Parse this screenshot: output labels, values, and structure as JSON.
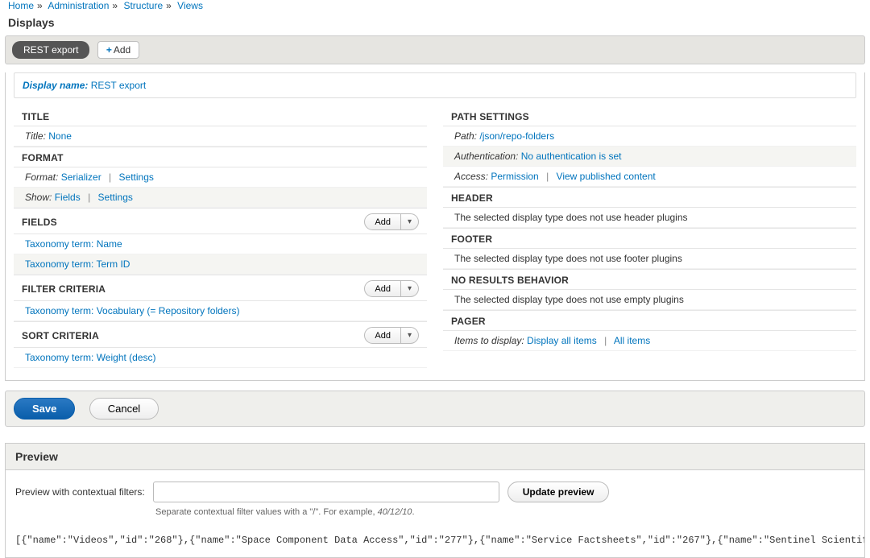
{
  "breadcrumb": [
    "Home",
    "Administration",
    "Structure",
    "Views"
  ],
  "displays_heading": "Displays",
  "tab_label": "REST export",
  "add_btn": "Add",
  "display_name": {
    "label": "Display name:",
    "value": "REST export"
  },
  "left": {
    "title": {
      "header": "TITLE",
      "row_label": "Title:",
      "row_value": "None"
    },
    "format": {
      "header": "FORMAT",
      "row1_label": "Format:",
      "row1_value": "Serializer",
      "row1_settings": "Settings",
      "row2_label": "Show:",
      "row2_value": "Fields",
      "row2_settings": "Settings"
    },
    "fields": {
      "header": "FIELDS",
      "add": "Add",
      "items": [
        "Taxonomy term: Name",
        "Taxonomy term: Term ID"
      ]
    },
    "filter": {
      "header": "FILTER CRITERIA",
      "add": "Add",
      "items": [
        "Taxonomy term: Vocabulary (= Repository folders)"
      ]
    },
    "sort": {
      "header": "SORT CRITERIA",
      "add": "Add",
      "items": [
        "Taxonomy term: Weight (desc)"
      ]
    }
  },
  "right": {
    "path": {
      "header": "PATH SETTINGS",
      "path_label": "Path:",
      "path_value": "/json/repo-folders",
      "auth_label": "Authentication:",
      "auth_value": "No authentication is set",
      "access_label": "Access:",
      "access_value": "Permission",
      "access_extra": "View published content"
    },
    "headerSec": {
      "header": "HEADER",
      "text": "The selected display type does not use header plugins"
    },
    "footerSec": {
      "header": "FOOTER",
      "text": "The selected display type does not use footer plugins"
    },
    "noresults": {
      "header": "NO RESULTS BEHAVIOR",
      "text": "The selected display type does not use empty plugins"
    },
    "pager": {
      "header": "PAGER",
      "label": "Items to display:",
      "value": "Display all items",
      "extra": "All items"
    }
  },
  "buttons": {
    "save": "Save",
    "cancel": "Cancel"
  },
  "preview": {
    "heading": "Preview",
    "label": "Preview with contextual filters:",
    "update": "Update preview",
    "hint_pre": "Separate contextual filter values with a \"/\". For example, ",
    "hint_ex": "40/12/10",
    "hint_post": "."
  },
  "output": "[{\"name\":\"Videos\",\"id\":\"268\"},{\"name\":\"Space Component Data Access\",\"id\":\"277\"},{\"name\":\"Service Factsheets\",\"id\":\"267\"},{\"name\":\"Sentinel Scientific Data Hub\",\"id\":"
}
